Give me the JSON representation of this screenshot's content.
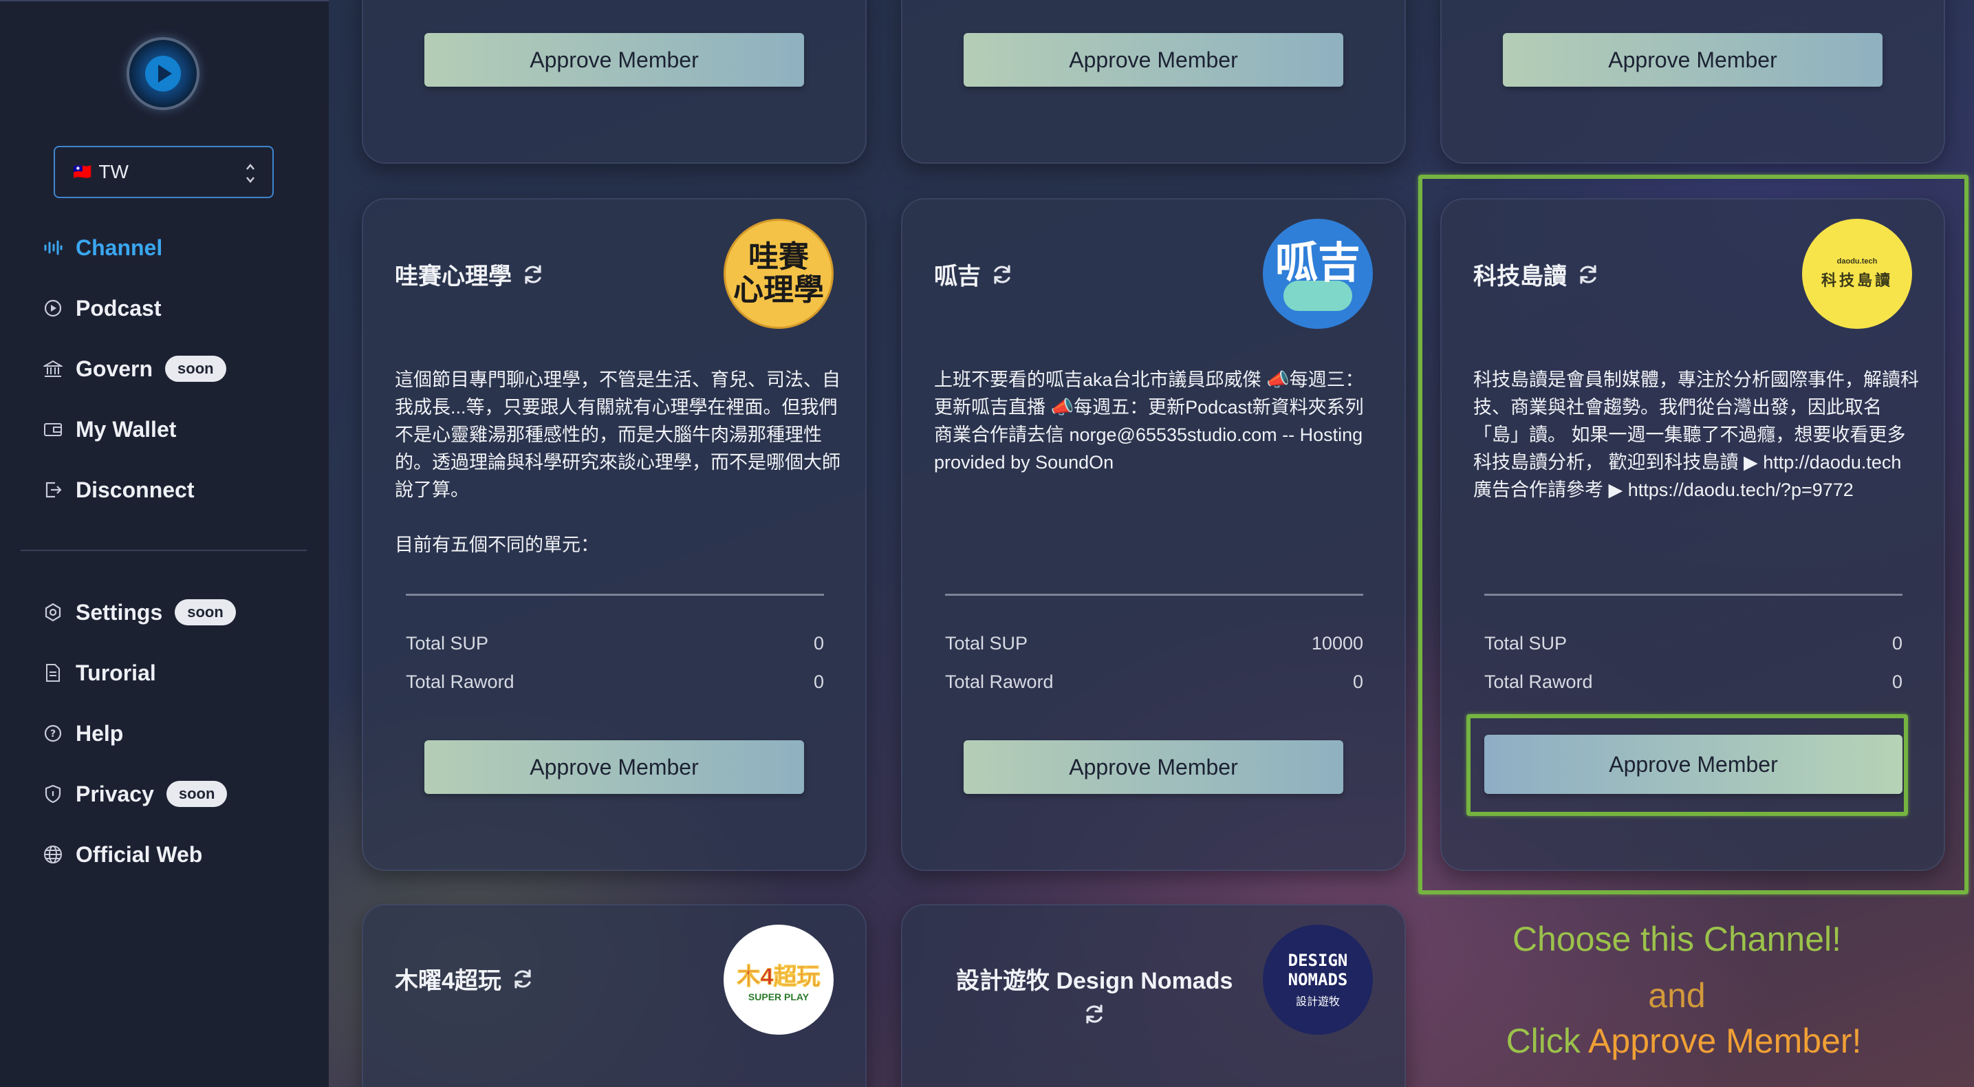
{
  "sidebar": {
    "region": {
      "flag": "🇹🇼",
      "value": "TW"
    },
    "nav": [
      {
        "label": "Channel",
        "icon": "waveform-icon",
        "badge": ""
      },
      {
        "label": "Podcast",
        "icon": "play-circle-icon",
        "badge": ""
      },
      {
        "label": "Govern",
        "icon": "bank-icon",
        "badge": "soon"
      },
      {
        "label": "My Wallet",
        "icon": "wallet-icon",
        "badge": ""
      },
      {
        "label": "Disconnect",
        "icon": "logout-icon",
        "badge": ""
      }
    ],
    "nav2": [
      {
        "label": "Settings",
        "icon": "settings-icon",
        "badge": "soon"
      },
      {
        "label": "Turorial",
        "icon": "document-icon",
        "badge": ""
      },
      {
        "label": "Help",
        "icon": "help-icon",
        "badge": ""
      },
      {
        "label": "Privacy",
        "icon": "shield-icon",
        "badge": "soon"
      },
      {
        "label": "Official Web",
        "icon": "globe-icon",
        "badge": ""
      }
    ]
  },
  "approve_label": "Approve Member",
  "stats_labels": {
    "sup": "Total SUP",
    "reward": "Total Raword"
  },
  "cards": [
    {
      "title": "哇賽心理學",
      "avatar_text": "哇賽\n心理學",
      "desc1": "這個節目專門聊心理學，不管是生活、育兒、司法、自我成長...等，只要跟人有關就有心理學在裡面。但我們不是心靈雞湯那種感性的，而是大腦牛肉湯那種理性的。透過理論與科學研究來談心理學，而不是哪個大師說了算。",
      "desc2": "目前有五個不同的單元：",
      "sup": "0",
      "reward": "0"
    },
    {
      "title": "呱吉",
      "avatar_text": "呱吉",
      "desc1": "上班不要看的呱吉aka台北市議員邱威傑 📣每週三：更新呱吉直播 📣每週五：更新Podcast新資料夾系列 商業合作請去信 norge@65535studio.com -- Hosting provided by SoundOn",
      "desc2": "",
      "sup": "10000",
      "reward": "0"
    },
    {
      "title": "科技島讀",
      "avatar_text": "科技島讀",
      "avatar_sub": "daodu.tech",
      "desc1": "科技島讀是會員制媒體，專注於分析國際事件，解讀科技、商業與社會趨勢。我們從台灣出發，因此取名「島」讀。 如果一週一集聽了不過癮，想要收看更多科技島讀分析， 歡迎到科技島讀 ▶ http://daodu.tech 廣告合作請參考 ▶ https://daodu.tech/?p=9772",
      "desc2": "",
      "sup": "0",
      "reward": "0"
    },
    {
      "title": "木曜4超玩",
      "avatar_text": "木4超玩",
      "avatar_sub": "SUPER PLAY"
    },
    {
      "title": "設計遊牧 Design Nomads",
      "avatar_text": "DESIGN NOMADS",
      "avatar_sub": "設計遊牧"
    }
  ],
  "callout": {
    "line1": "Choose this Channel!",
    "line2": "and",
    "line3a": "Click ",
    "line3b": "Approve Member!"
  },
  "colors": {
    "active": "#3aa7f0",
    "highlight": "#76b441",
    "callout_green": "#9bc24a",
    "callout_orange": "#f0a035"
  }
}
